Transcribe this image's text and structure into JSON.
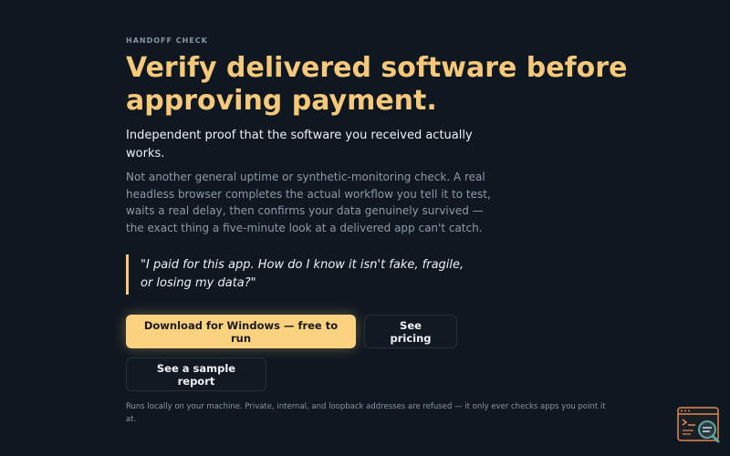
{
  "hero": {
    "eyebrow": "HANDOFF CHECK",
    "title": "Verify delivered software before approving payment.",
    "subtitle": "Independent proof that the software you received actually works.",
    "description": "Not another general uptime or synthetic-monitoring check. A real headless browser completes the actual workflow you tell it to test, waits a real delay, then confirms your data genuinely survived — the exact thing a five-minute look at a delivered app can't catch.",
    "quote": "\"I paid for this app. How do I know it isn't fake, fragile, or losing my data?\""
  },
  "actions": {
    "download_label": "Download for Windows — free to run",
    "pricing_label": "See pricing",
    "sample_label": "See a sample report"
  },
  "footnote": "Runs locally on your machine. Private, internal, and loopback addresses are refused — it only ever checks apps you point it at.",
  "widget": {
    "icon": "terminal-search-icon"
  },
  "colors": {
    "background": "#0f1720",
    "accent": "#f6c97a",
    "button_primary": "#fbd27f",
    "widget_orange": "#e08a52",
    "widget_teal": "#5fa8a0"
  }
}
